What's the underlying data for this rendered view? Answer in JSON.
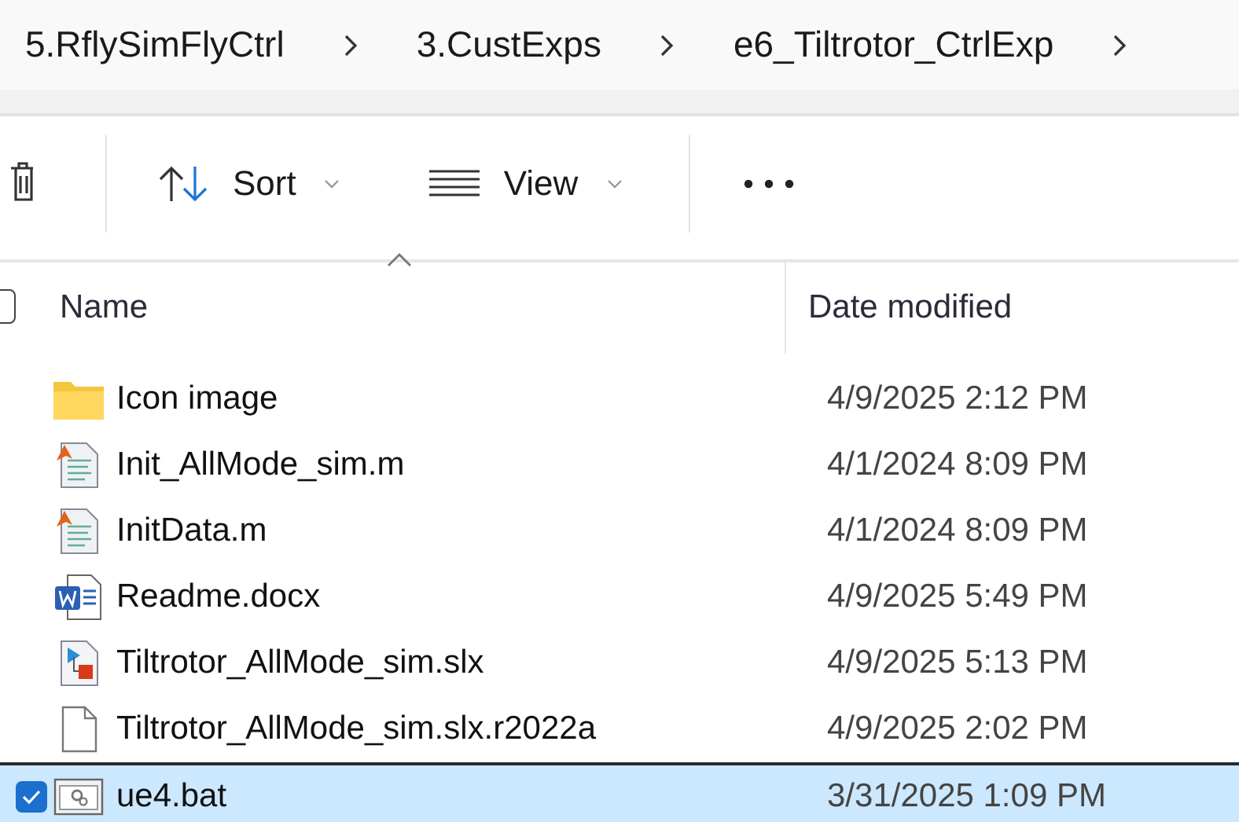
{
  "breadcrumb": [
    {
      "label": "5.RflySimFlyCtrl"
    },
    {
      "label": "3.CustExps"
    },
    {
      "label": "e6_Tiltrotor_CtrlExp"
    }
  ],
  "toolbar": {
    "sort": "Sort",
    "view": "View"
  },
  "columns": [
    {
      "label": "Name",
      "sorted": true
    },
    {
      "label": "Date modified"
    }
  ],
  "header_checkbox": {
    "checked": false
  },
  "files": [
    {
      "name": "Icon image",
      "date": "4/9/2025 2:12 PM",
      "kind": "folder",
      "selected": false
    },
    {
      "name": "Init_AllMode_sim.m",
      "date": "4/1/2024 8:09 PM",
      "kind": "matlab",
      "selected": false
    },
    {
      "name": "InitData.m",
      "date": "4/1/2024 8:09 PM",
      "kind": "matlab",
      "selected": false
    },
    {
      "name": "Readme.docx",
      "date": "4/9/2025 5:49 PM",
      "kind": "word",
      "selected": false
    },
    {
      "name": "Tiltrotor_AllMode_sim.slx",
      "date": "4/9/2025 5:13 PM",
      "kind": "simulink",
      "selected": false
    },
    {
      "name": "Tiltrotor_AllMode_sim.slx.r2022a",
      "date": "4/9/2025 2:02 PM",
      "kind": "file",
      "selected": false
    },
    {
      "name": "ue4.bat",
      "date": "3/31/2025 1:09 PM",
      "kind": "bat",
      "selected": true
    }
  ]
}
